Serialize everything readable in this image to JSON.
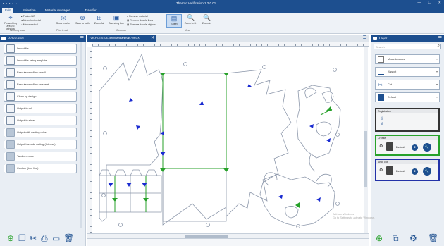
{
  "app": {
    "title": "Thermo Verification 1.2.0.01",
    "quick_access": "▪ ▪ ▪ ▪ ▪",
    "window_controls": [
      "—",
      "☐",
      "✕"
    ]
  },
  "menu": {
    "tabs": [
      "Edit",
      "Selection",
      "Material manager",
      "Transfer"
    ],
    "active_index": 0
  },
  "ribbon": {
    "buttons": [
      {
        "label": "Fix working area to window",
        "icon": "⌖"
      },
      {
        "label": "Show marker",
        "icon": "◎"
      },
      {
        "label": "Snap to path",
        "icon": "⊕"
      },
      {
        "label": "Zoom full",
        "icon": "⊞"
      },
      {
        "label": "Bounding box",
        "icon": "▣"
      },
      {
        "label": "Show positions",
        "icon": "⌂"
      },
      {
        "label": "Sheet",
        "icon": "▤"
      },
      {
        "label": "Zoom to fit",
        "icon": "🔍"
      },
      {
        "label": "Zoom in",
        "icon": "🔍"
      },
      {
        "label": "Zoom out",
        "icon": "🔍"
      }
    ],
    "small_items": [
      {
        "label": "Flatten NIT",
        "icon": "▸"
      },
      {
        "label": "Mirror horizontal",
        "icon": "◂"
      },
      {
        "label": "Mirror vertical",
        "icon": "▴"
      },
      {
        "label": "Remove material",
        "icon": "●"
      },
      {
        "label": "Remove double lines",
        "icon": "▤"
      },
      {
        "label": "Remove double objects",
        "icon": "▤"
      }
    ],
    "groups": [
      "Working area",
      "Print & cut",
      "Clean up",
      "View"
    ],
    "selected_index": 6
  },
  "left_panel": {
    "title": "Action sets",
    "operations": [
      {
        "label": "Import file",
        "disabled": false
      },
      {
        "label": "Import file using template",
        "disabled": false
      },
      {
        "label": "Execute workflow on roll",
        "disabled": false
      },
      {
        "label": "Execute workflow on sheet",
        "disabled": false
      },
      {
        "label": "Clean up design",
        "disabled": false
      },
      {
        "label": "Output to roll",
        "disabled": false
      },
      {
        "label": "Output to sheet",
        "disabled": false
      },
      {
        "label": "Output with nesting rules",
        "disabled": true
      },
      {
        "label": "Output barcode cutting (Intense)",
        "disabled": true
      },
      {
        "label": "Tandem mode",
        "disabled": true
      },
      {
        "label": "Contour (trim line)",
        "disabled": true
      }
    ],
    "footer_icons": [
      "plus-icon",
      "copy-icon",
      "tools-icon",
      "export-icon",
      "save-icon",
      "delete-icon"
    ]
  },
  "document": {
    "tab_label": "TVR-FILE-0104-cardboard-animals.WPDX",
    "close_label": "✕",
    "menu_label": "☰"
  },
  "right_panel": {
    "title": "Layer",
    "search_placeholder": "Search",
    "layers": [
      {
        "label": "Miscellaneous",
        "icon_color": "#ffffff"
      },
      {
        "label": "Kisscut",
        "icon_color": "#1d4f8f"
      },
      {
        "label": "Cut",
        "icon_color": "#1d4f8f"
      },
      {
        "label": "Default",
        "icon_color": "#1d4f8f"
      }
    ],
    "groups": [
      {
        "title": "Registration",
        "border": "#333333",
        "label": ""
      },
      {
        "title": "Crease",
        "border": "#27a12a",
        "label": "Default"
      },
      {
        "title": "Shoe cut",
        "border": "#2332a8",
        "label": "Default"
      }
    ],
    "footer_icons": [
      "plus-icon",
      "layer-icon",
      "settings-icon",
      "delete-icon"
    ]
  },
  "watermark": [
    "Activate Windows",
    "Go to Settings to activate Windows."
  ],
  "colors": {
    "brand": "#1d4f8f",
    "crease": "#27a12a",
    "cut_line": "#8d98ab",
    "arrow": "#1a2bd0"
  }
}
